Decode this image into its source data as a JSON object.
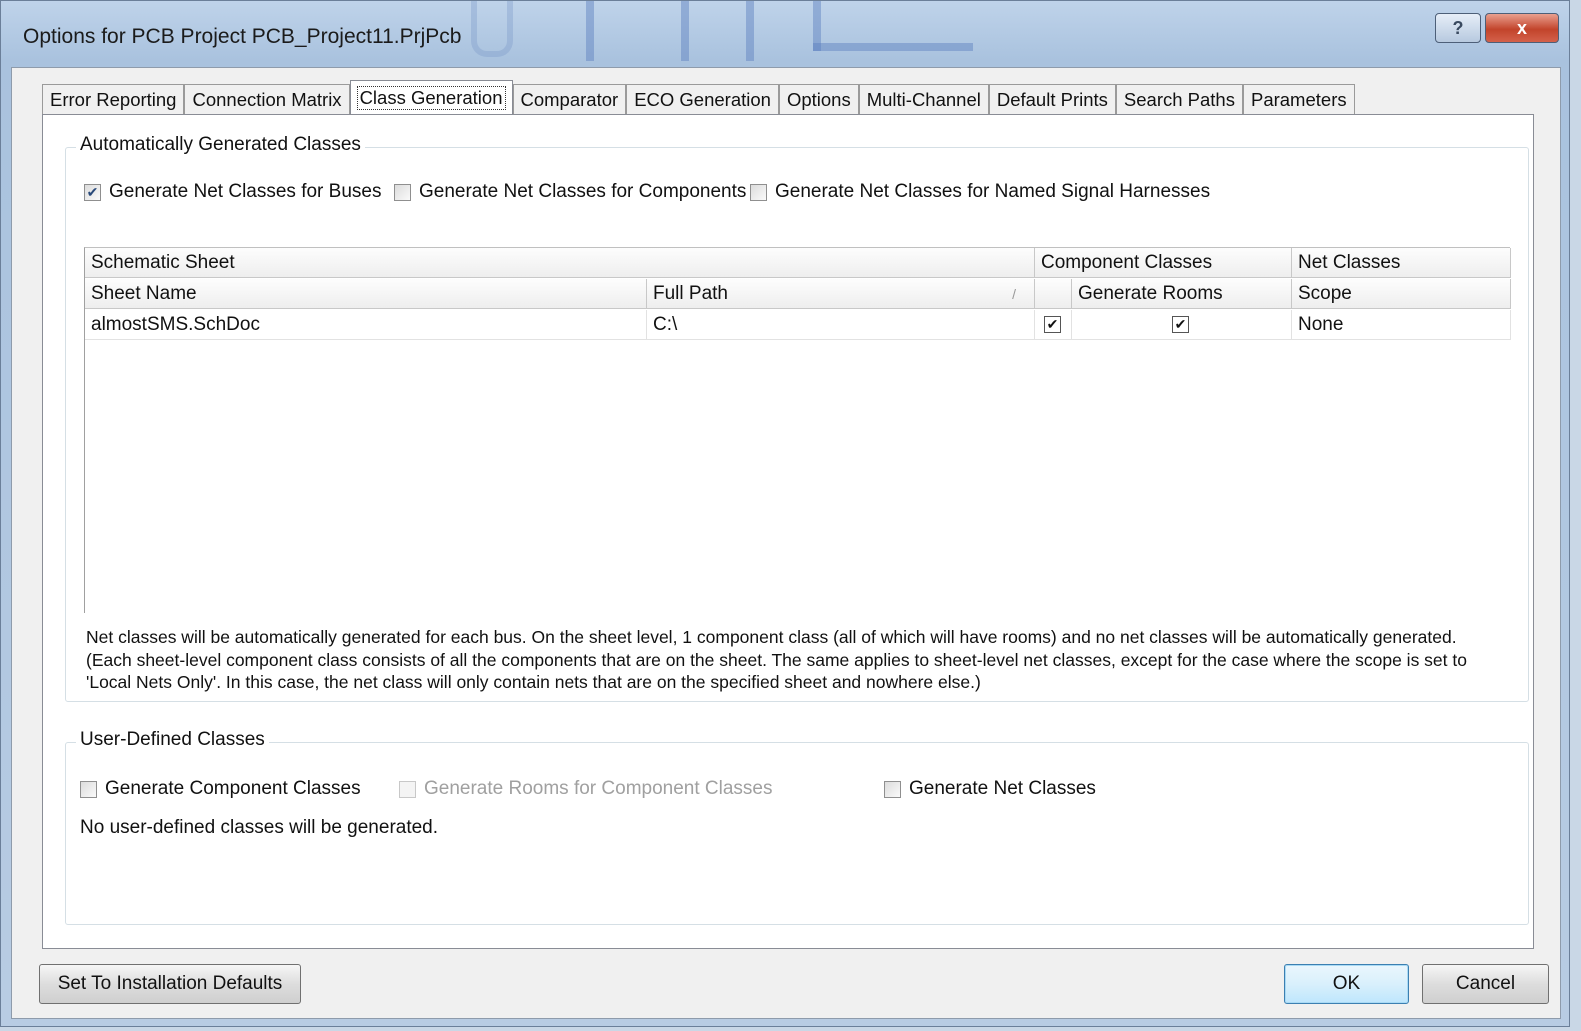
{
  "window": {
    "title": "Options for PCB Project PCB_Project11.PrjPcb",
    "help_label": "?",
    "close_label": "x"
  },
  "tabs": [
    {
      "label": "Error Reporting"
    },
    {
      "label": "Connection Matrix"
    },
    {
      "label": "Class Generation"
    },
    {
      "label": "Comparator"
    },
    {
      "label": "ECO Generation"
    },
    {
      "label": "Options"
    },
    {
      "label": "Multi-Channel"
    },
    {
      "label": "Default Prints"
    },
    {
      "label": "Search Paths"
    },
    {
      "label": "Parameters"
    }
  ],
  "auto": {
    "group_label": "Automatically Generated Classes",
    "cb_buses": {
      "label": "Generate Net Classes for Buses",
      "checked": true
    },
    "cb_components": {
      "label": "Generate Net Classes for Components",
      "checked": false
    },
    "cb_harnesses": {
      "label": "Generate Net Classes for Named Signal Harnesses",
      "checked": false
    },
    "grid": {
      "band_schematic": "Schematic Sheet",
      "band_component": "Component Classes",
      "band_net": "Net Classes",
      "col_sheet_name": "Sheet Name",
      "col_full_path": "Full Path",
      "col_generate_rooms": "Generate Rooms",
      "col_scope": "Scope",
      "sort_indicator": "/",
      "rows": [
        {
          "sheet_name": "almostSMS.SchDoc",
          "full_path": "C:\\",
          "component_class": true,
          "generate_rooms": true,
          "scope": "None"
        }
      ]
    },
    "description": "Net classes will be automatically generated for each bus. On the sheet level, 1 component class (all of which will have rooms) and no net classes will be automatically generated. (Each sheet-level component class consists of all the components that are on the sheet. The same applies to sheet-level net classes, except for the case where the scope is set to 'Local Nets Only'. In this case, the net class will only contain nets that are on the specified sheet and nowhere else.)"
  },
  "user": {
    "group_label": "User-Defined Classes",
    "cb_component_classes": {
      "label": "Generate Component Classes",
      "checked": false
    },
    "cb_rooms": {
      "label": "Generate Rooms for Component Classes",
      "checked": false,
      "disabled": true
    },
    "cb_net_classes": {
      "label": "Generate Net Classes",
      "checked": false
    },
    "status": "No user-defined classes will be generated."
  },
  "buttons": {
    "defaults": "Set To Installation Defaults",
    "ok": "OK",
    "cancel": "Cancel"
  },
  "colors": {
    "accent": "#3c7fb1",
    "close": "#c2442b"
  }
}
